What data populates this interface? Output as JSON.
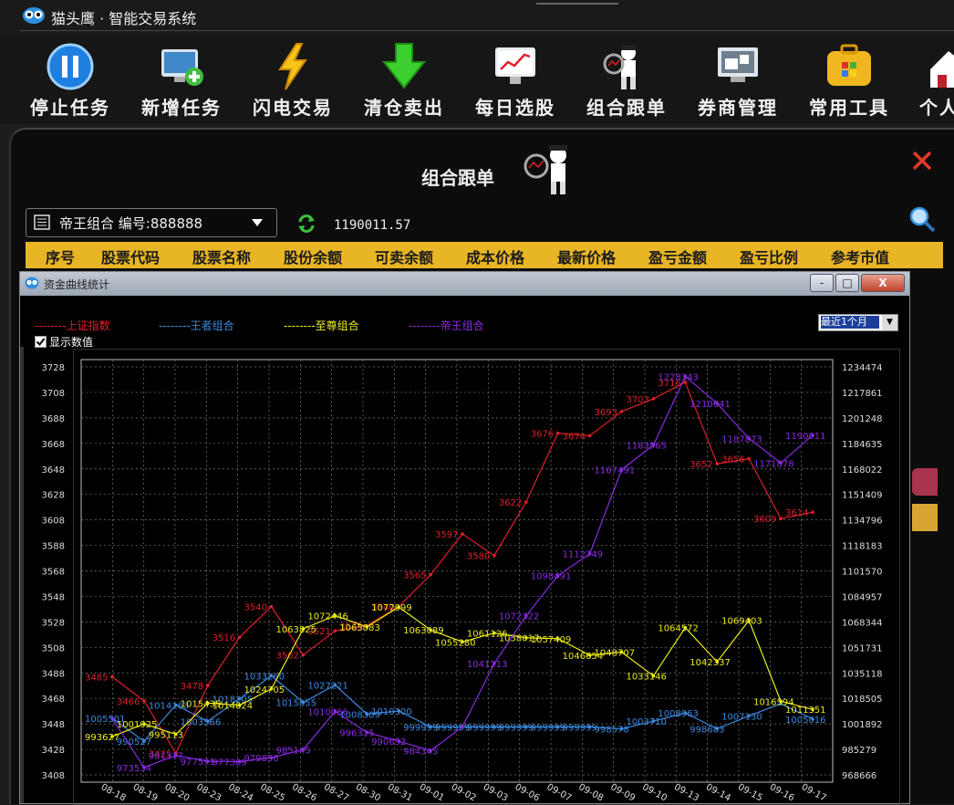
{
  "app": {
    "title": "猫头鹰 · 智能交易系统"
  },
  "toolbar": {
    "items": [
      {
        "label": "停止任务",
        "icon": "pause-icon"
      },
      {
        "label": "新增任务",
        "icon": "add-monitor-icon"
      },
      {
        "label": "闪电交易",
        "icon": "lightning-icon"
      },
      {
        "label": "清仓卖出",
        "icon": "down-arrow-icon"
      },
      {
        "label": "每日选股",
        "icon": "chart-monitor-icon"
      },
      {
        "label": "组合跟单",
        "icon": "detective-icon"
      },
      {
        "label": "券商管理",
        "icon": "broker-icon"
      },
      {
        "label": "常用工具",
        "icon": "tools-icon"
      },
      {
        "label": "个人",
        "icon": "home-icon"
      }
    ]
  },
  "panel": {
    "title": "组合跟单",
    "portfolio_select": "帝王组合 编号:888888",
    "balance": "1190011.57"
  },
  "table_header": [
    "序号",
    "股票代码",
    "股票名称",
    "股份余额",
    "可卖余额",
    "成本价格",
    "最新价格",
    "盈亏金额",
    "盈亏比例",
    "参考市值"
  ],
  "window": {
    "title": "资金曲线统计",
    "min": "-",
    "max": "□",
    "close": "X",
    "show_values_label": "显示数值",
    "range_selected": "最近1个月"
  },
  "legend": [
    {
      "label": "--------上证指数",
      "color": "#e0202a"
    },
    {
      "label": "--------王者组合",
      "color": "#3b8be0"
    },
    {
      "label": "--------至尊组合",
      "color": "#ecec1a"
    },
    {
      "label": "--------帝王组合",
      "color": "#8a2be2"
    }
  ],
  "chart_data": {
    "type": "line",
    "x": [
      "08-18",
      "08-19",
      "08-20",
      "08-23",
      "08-24",
      "08-25",
      "08-26",
      "08-27",
      "08-30",
      "08-31",
      "09-01",
      "09-02",
      "09-03",
      "09-06",
      "09-07",
      "09-08",
      "09-09",
      "09-10",
      "09-13",
      "09-14",
      "09-15",
      "09-16",
      "09-17"
    ],
    "y_left": {
      "ticks": [
        3728,
        3708,
        3688,
        3668,
        3648,
        3628,
        3608,
        3588,
        3568,
        3548,
        3528,
        3508,
        3488,
        3468,
        3448,
        3428,
        3408
      ],
      "ylim": [
        3408,
        3728
      ]
    },
    "y_right": {
      "ticks": [
        1234474,
        1217861,
        1201248,
        1184635,
        1168022,
        1151409,
        1134796,
        1118183,
        1101570,
        1084957,
        1068344,
        1051731,
        1035118,
        1018505,
        1001892,
        985279,
        968666
      ],
      "ylim": [
        968666,
        1234474
      ]
    },
    "grid": true,
    "series": [
      {
        "name": "上证指数",
        "axis": "left",
        "color": "#e0202a",
        "values": [
          3485,
          3466,
          3425,
          3478,
          3516,
          3540,
          3502,
          3521,
          3525,
          3540,
          3565,
          3597,
          3580,
          3622,
          3676,
          3674,
          3693,
          3703,
          3716,
          3652,
          3656,
          3609,
          3614
        ],
        "labels": [
          "3485",
          "3466",
          "3425",
          "3478",
          "3516",
          "3540",
          "3502",
          "3521",
          "3525",
          "3540",
          "3565",
          "3597",
          "3580",
          "3622",
          "3676",
          "3674",
          "3693",
          "3703",
          "3716",
          "3652",
          "3656",
          "3609",
          "3614"
        ]
      },
      {
        "name": "王者组合",
        "axis": "right",
        "color": "#3b8be0",
        "values": [
          1005501,
          990527,
          1014163,
          1003566,
          1018205,
          1033260,
          1015855,
          1027221,
          1008309,
          1010300,
          999999,
          999999,
          999999,
          999999,
          999999,
          999999,
          998578,
          1003710,
          1008963,
          998683,
          1007130,
          1015016,
          1005016
        ],
        "labels": [
          "1005501",
          "990527",
          "1014163",
          "1003566",
          "1018205",
          "1033260",
          "1015855",
          "1027221",
          "1008309",
          "1010300",
          "999999",
          "999999",
          "999999",
          "999999",
          "999999",
          "999999",
          "998578",
          "1003710",
          "1008963",
          "998683",
          "1007130",
          "",
          "1005016"
        ]
      },
      {
        "name": "至尊组合",
        "axis": "right",
        "color": "#ecec1a",
        "values": [
          993627,
          1001925,
          995113,
          1015435,
          1014024,
          1024705,
          1063825,
          1072446,
          1065083,
          1077999,
          1063089,
          1055280,
          1061126,
          1058017,
          1057409,
          1046654,
          1048707,
          1033146,
          1064572,
          1042337,
          1069403,
          1016594,
          1011351
        ],
        "labels": [
          "993627",
          "1001925",
          "995113",
          "1015435",
          "1014024",
          "1024705",
          "1063825",
          "1072446",
          "1065083",
          "1077999",
          "1063089",
          "1055280",
          "1061126",
          "1058017",
          "1057409",
          "1046654",
          "1048707",
          "1033146",
          "1064572",
          "1042337",
          "1069403",
          "1016594",
          "1011351"
        ]
      },
      {
        "name": "帝王组合",
        "axis": "right",
        "color": "#8a2be2",
        "values": [
          1005501,
          973534,
          981317,
          977591,
          977309,
          979856,
          985145,
          1010066,
          996315,
          990652,
          984345,
          999999,
          1041213,
          1072322,
          1098491,
          1112749,
          1167491,
          1183565,
          1228343,
          1210641,
          1187873,
          1171878,
          1190011
        ],
        "labels": [
          "",
          "973534",
          "981317",
          "977591",
          "977309",
          "979856",
          "985145",
          "1010066",
          "996315",
          "990652",
          "984345",
          "",
          "1041213",
          "1072322",
          "1098491",
          "1112749",
          "1167491",
          "1183565",
          "1228343",
          "1210641",
          "1187873",
          "1171878",
          "1190011"
        ]
      }
    ]
  }
}
